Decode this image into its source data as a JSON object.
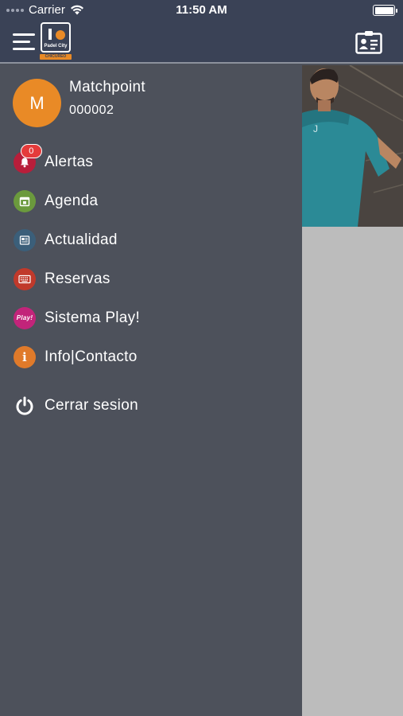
{
  "status_bar": {
    "carrier": "Carrier",
    "time": "11:50 AM"
  },
  "header": {
    "menu_icon": "hamburger-icon",
    "logo_text": "Padel City",
    "logo_ribbon": "CHICUREO",
    "action_icon": "id-card-icon",
    "background_color": "#3a4256"
  },
  "profile": {
    "avatar_initial": "M",
    "name": "Matchpoint",
    "code": "000002",
    "avatar_color": "#e98a26"
  },
  "menu": {
    "items": [
      {
        "label": "Alertas",
        "icon": "bell-icon",
        "color": "#b81e3a",
        "badge": "0"
      },
      {
        "label": "Agenda",
        "icon": "calendar-icon",
        "color": "#6b9a3d"
      },
      {
        "label": "Actualidad",
        "icon": "news-icon",
        "color": "#3b5f7a"
      },
      {
        "label": "Reservas",
        "icon": "keyboard-icon",
        "color": "#c0392b"
      },
      {
        "label": "Sistema Play!",
        "icon": "play-icon",
        "icon_text": "Play!",
        "color": "#c2247a"
      },
      {
        "label": "Info|Contacto",
        "icon": "info-icon",
        "icon_text": "i",
        "color": "#e07a2a"
      }
    ],
    "logout": {
      "label": "Cerrar sesion",
      "icon": "power-icon"
    }
  },
  "drawer_color": "#4d515b",
  "content_background": "#bcbcbc"
}
